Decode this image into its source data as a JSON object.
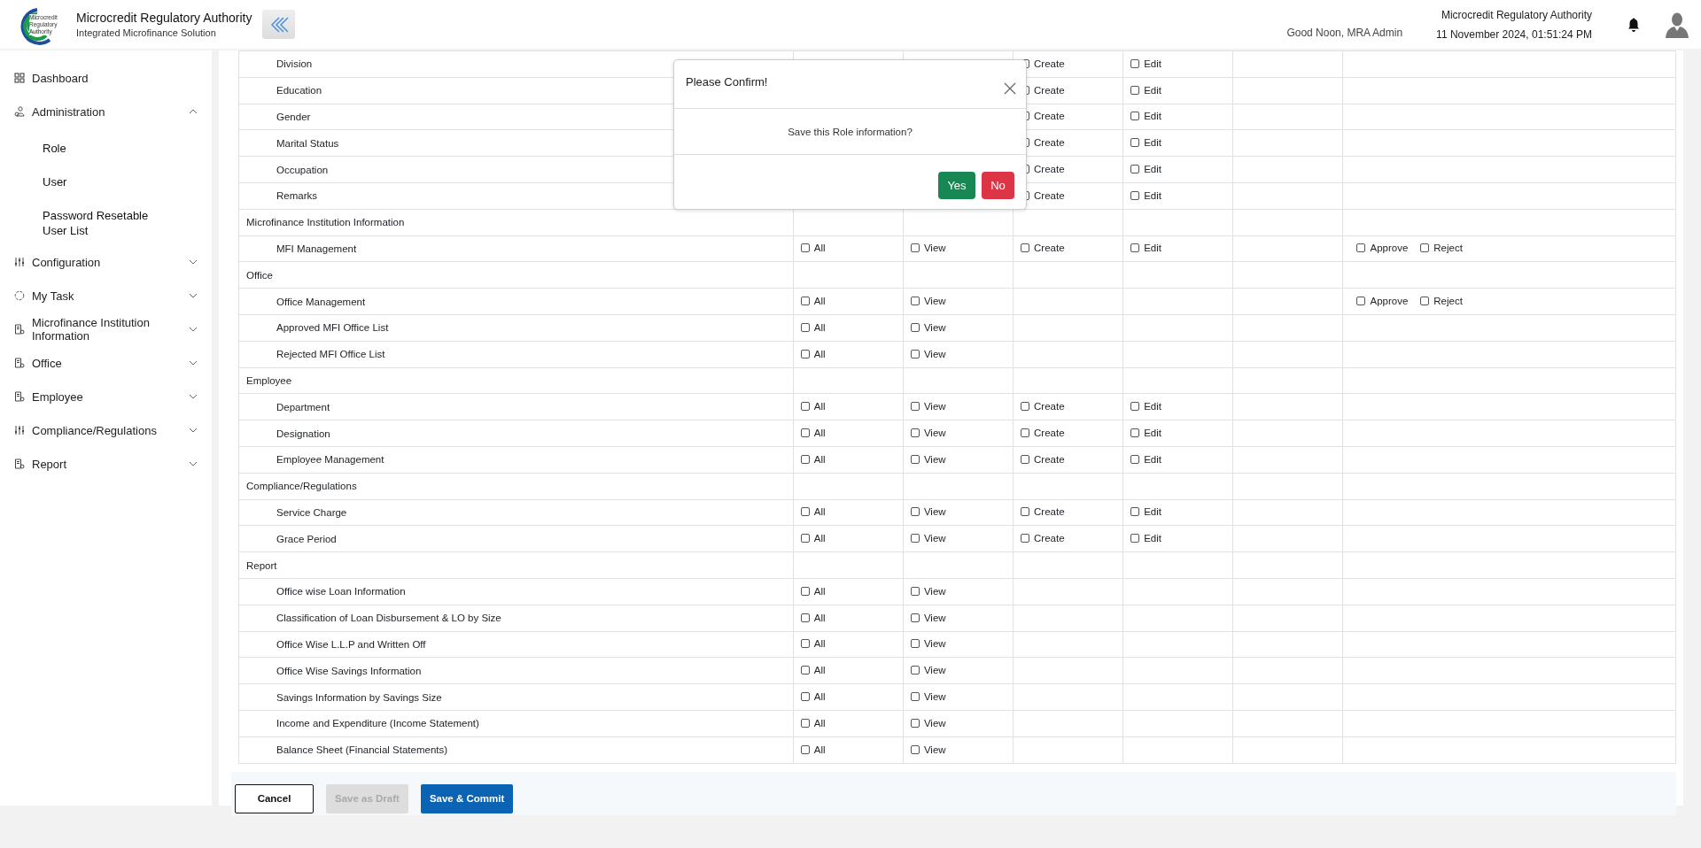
{
  "header": {
    "logo_lines": [
      "Microcredit",
      "Regulatory",
      "Authority"
    ],
    "title": "Microcredit Regulatory Authority",
    "subtitle": "Integrated Microfinance Solution",
    "greeting": "Good Noon, MRA Admin",
    "org": "Microcredit Regulatory Authority",
    "datetime": "11 November 2024, 01:51:24 PM"
  },
  "sidebar": {
    "items": [
      {
        "label": "Dashboard",
        "kind": "link"
      },
      {
        "label": "Administration",
        "kind": "menu",
        "expanded": true,
        "children": [
          {
            "label": "Role"
          },
          {
            "label": "User"
          },
          {
            "label": "Password Resetable User List"
          }
        ]
      },
      {
        "label": "Configuration",
        "kind": "menu",
        "expanded": false
      },
      {
        "label": "My Task",
        "kind": "menu",
        "expanded": false
      },
      {
        "label": "Microfinance Institution Information",
        "kind": "menu",
        "expanded": false
      },
      {
        "label": "Office",
        "kind": "menu",
        "expanded": false
      },
      {
        "label": "Employee",
        "kind": "menu",
        "expanded": false
      },
      {
        "label": "Compliance/Regulations",
        "kind": "menu",
        "expanded": false
      },
      {
        "label": "Report",
        "kind": "menu",
        "expanded": false
      }
    ]
  },
  "table": {
    "rows": [
      {
        "kind": "item",
        "label": "Division",
        "perms": [
          {
            "kind": "create",
            "label": "Create",
            "checked": false
          },
          {
            "kind": "edit",
            "label": "Edit",
            "checked": false
          }
        ]
      },
      {
        "kind": "item",
        "label": "Education",
        "perms": [
          {
            "kind": "create",
            "label": "Create",
            "checked": false
          },
          {
            "kind": "edit",
            "label": "Edit",
            "checked": false
          }
        ]
      },
      {
        "kind": "item",
        "label": "Gender",
        "perms": [
          {
            "kind": "create",
            "label": "Create",
            "checked": false
          },
          {
            "kind": "edit",
            "label": "Edit",
            "checked": false
          }
        ]
      },
      {
        "kind": "item",
        "label": "Marital Status",
        "perms": [
          {
            "kind": "create",
            "label": "Create",
            "checked": false
          },
          {
            "kind": "edit",
            "label": "Edit",
            "checked": false
          }
        ]
      },
      {
        "kind": "item",
        "label": "Occupation",
        "perms": [
          {
            "kind": "create",
            "label": "Create",
            "checked": false
          },
          {
            "kind": "edit",
            "label": "Edit",
            "checked": false
          }
        ]
      },
      {
        "kind": "item",
        "label": "Remarks",
        "perms": [
          {
            "kind": "create",
            "label": "Create",
            "checked": false
          },
          {
            "kind": "edit",
            "label": "Edit",
            "checked": false
          }
        ]
      },
      {
        "kind": "group",
        "label": "Microfinance Institution Information"
      },
      {
        "kind": "item",
        "label": "MFI Management",
        "perms": [
          {
            "kind": "all",
            "label": "All",
            "checked": false
          },
          {
            "kind": "view",
            "label": "View",
            "checked": false
          },
          {
            "kind": "create",
            "label": "Create",
            "checked": false
          },
          {
            "kind": "edit",
            "label": "Edit",
            "checked": false
          },
          {
            "kind": "approve",
            "label": "Approve",
            "checked": false
          },
          {
            "kind": "reject",
            "label": "Reject",
            "checked": false
          }
        ]
      },
      {
        "kind": "group",
        "label": "Office"
      },
      {
        "kind": "item",
        "label": "Office Management",
        "perms": [
          {
            "kind": "all",
            "label": "All",
            "checked": false
          },
          {
            "kind": "view",
            "label": "View",
            "checked": false
          },
          {
            "kind": "approve",
            "label": "Approve",
            "checked": false
          },
          {
            "kind": "reject",
            "label": "Reject",
            "checked": false
          }
        ]
      },
      {
        "kind": "item",
        "label": "Approved MFI Office List",
        "perms": [
          {
            "kind": "all",
            "label": "All",
            "checked": false
          },
          {
            "kind": "view",
            "label": "View",
            "checked": false
          }
        ]
      },
      {
        "kind": "item",
        "label": "Rejected MFI Office List",
        "perms": [
          {
            "kind": "all",
            "label": "All",
            "checked": false
          },
          {
            "kind": "view",
            "label": "View",
            "checked": false
          }
        ]
      },
      {
        "kind": "group",
        "label": "Employee"
      },
      {
        "kind": "item",
        "label": "Department",
        "perms": [
          {
            "kind": "all",
            "label": "All",
            "checked": false
          },
          {
            "kind": "view",
            "label": "View",
            "checked": false
          },
          {
            "kind": "create",
            "label": "Create",
            "checked": false
          },
          {
            "kind": "edit",
            "label": "Edit",
            "checked": false
          }
        ]
      },
      {
        "kind": "item",
        "label": "Designation",
        "perms": [
          {
            "kind": "all",
            "label": "All",
            "checked": false
          },
          {
            "kind": "view",
            "label": "View",
            "checked": false
          },
          {
            "kind": "create",
            "label": "Create",
            "checked": false
          },
          {
            "kind": "edit",
            "label": "Edit",
            "checked": false
          }
        ]
      },
      {
        "kind": "item",
        "label": "Employee Management",
        "perms": [
          {
            "kind": "all",
            "label": "All",
            "checked": false
          },
          {
            "kind": "view",
            "label": "View",
            "checked": false
          },
          {
            "kind": "create",
            "label": "Create",
            "checked": false
          },
          {
            "kind": "edit",
            "label": "Edit",
            "checked": false
          }
        ]
      },
      {
        "kind": "group",
        "label": "Compliance/Regulations"
      },
      {
        "kind": "item",
        "label": "Service Charge",
        "perms": [
          {
            "kind": "all",
            "label": "All",
            "checked": false
          },
          {
            "kind": "view",
            "label": "View",
            "checked": false
          },
          {
            "kind": "create",
            "label": "Create",
            "checked": false
          },
          {
            "kind": "edit",
            "label": "Edit",
            "checked": false
          }
        ]
      },
      {
        "kind": "item",
        "label": "Grace Period",
        "perms": [
          {
            "kind": "all",
            "label": "All",
            "checked": false
          },
          {
            "kind": "view",
            "label": "View",
            "checked": false
          },
          {
            "kind": "create",
            "label": "Create",
            "checked": false
          },
          {
            "kind": "edit",
            "label": "Edit",
            "checked": false
          }
        ]
      },
      {
        "kind": "group",
        "label": "Report"
      },
      {
        "kind": "item",
        "label": "Office wise Loan Information",
        "perms": [
          {
            "kind": "all",
            "label": "All",
            "checked": false
          },
          {
            "kind": "view",
            "label": "View",
            "checked": false
          }
        ]
      },
      {
        "kind": "item",
        "label": "Classification of Loan Disbursement & LO by Size",
        "perms": [
          {
            "kind": "all",
            "label": "All",
            "checked": false
          },
          {
            "kind": "view",
            "label": "View",
            "checked": false
          }
        ]
      },
      {
        "kind": "item",
        "label": "Office Wise L.L.P and Written Off",
        "perms": [
          {
            "kind": "all",
            "label": "All",
            "checked": false
          },
          {
            "kind": "view",
            "label": "View",
            "checked": false
          }
        ]
      },
      {
        "kind": "item",
        "label": "Office Wise Savings Information",
        "perms": [
          {
            "kind": "all",
            "label": "All",
            "checked": false
          },
          {
            "kind": "view",
            "label": "View",
            "checked": false
          }
        ]
      },
      {
        "kind": "item",
        "label": "Savings Information by Savings Size",
        "perms": [
          {
            "kind": "all",
            "label": "All",
            "checked": false
          },
          {
            "kind": "view",
            "label": "View",
            "checked": false
          }
        ]
      },
      {
        "kind": "item",
        "label": "Income and Expenditure (Income Statement)",
        "perms": [
          {
            "kind": "all",
            "label": "All",
            "checked": false
          },
          {
            "kind": "view",
            "label": "View",
            "checked": false
          }
        ]
      },
      {
        "kind": "item",
        "label": "Balance Sheet (Financial Statements)",
        "perms": [
          {
            "kind": "all",
            "label": "All",
            "checked": false
          },
          {
            "kind": "view",
            "label": "View",
            "checked": false
          }
        ]
      }
    ]
  },
  "actions": [
    {
      "label": "Cancel",
      "kind": "outline",
      "disabled": false
    },
    {
      "label": "Save as Draft",
      "kind": "secondary",
      "disabled": true
    },
    {
      "label": "Save & Commit",
      "kind": "primary",
      "disabled": false
    }
  ],
  "dialog": {
    "title": "Please Confirm!",
    "message": "Save this Role information?",
    "buttons": [
      {
        "label": "Yes",
        "kind": "confirm"
      },
      {
        "label": "No",
        "kind": "cancel"
      }
    ]
  }
}
